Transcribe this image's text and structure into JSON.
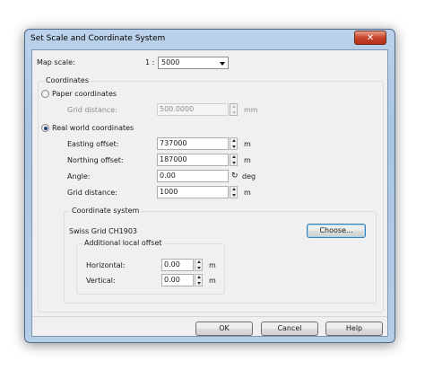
{
  "window": {
    "title": "Set Scale and Coordinate System",
    "close_glyph": "✕"
  },
  "map_scale": {
    "label": "Map scale:",
    "prefix": "1 :",
    "value": "5000"
  },
  "coordinates": {
    "title": "Coordinates",
    "paper": {
      "label": "Paper coordinates",
      "grid_distance_label": "Grid distance:",
      "grid_distance_value": "500.0000",
      "unit": "mm"
    },
    "real": {
      "label": "Real world coordinates",
      "easting_label": "Easting offset:",
      "easting_value": "737000",
      "easting_unit": "m",
      "northing_label": "Northing offset:",
      "northing_value": "187000",
      "northing_unit": "m",
      "angle_label": "Angle:",
      "angle_value": "0.00",
      "angle_unit": "deg",
      "grid_label": "Grid distance:",
      "grid_value": "1000",
      "grid_unit": "m"
    },
    "coordinate_system": {
      "title": "Coordinate system",
      "name": "Swiss Grid  CH1903",
      "choose_label": "Choose...",
      "local_offset": {
        "title": "Additional local offset",
        "horizontal_label": "Horizontal:",
        "horizontal_value": "0.00",
        "horizontal_unit": "m",
        "vertical_label": "Vertical:",
        "vertical_value": "0.00",
        "vertical_unit": "m"
      }
    }
  },
  "buttons": {
    "ok": "OK",
    "cancel": "Cancel",
    "help": "Help"
  },
  "icons": {
    "rotate": "rotate-icon",
    "close": "close-icon"
  }
}
